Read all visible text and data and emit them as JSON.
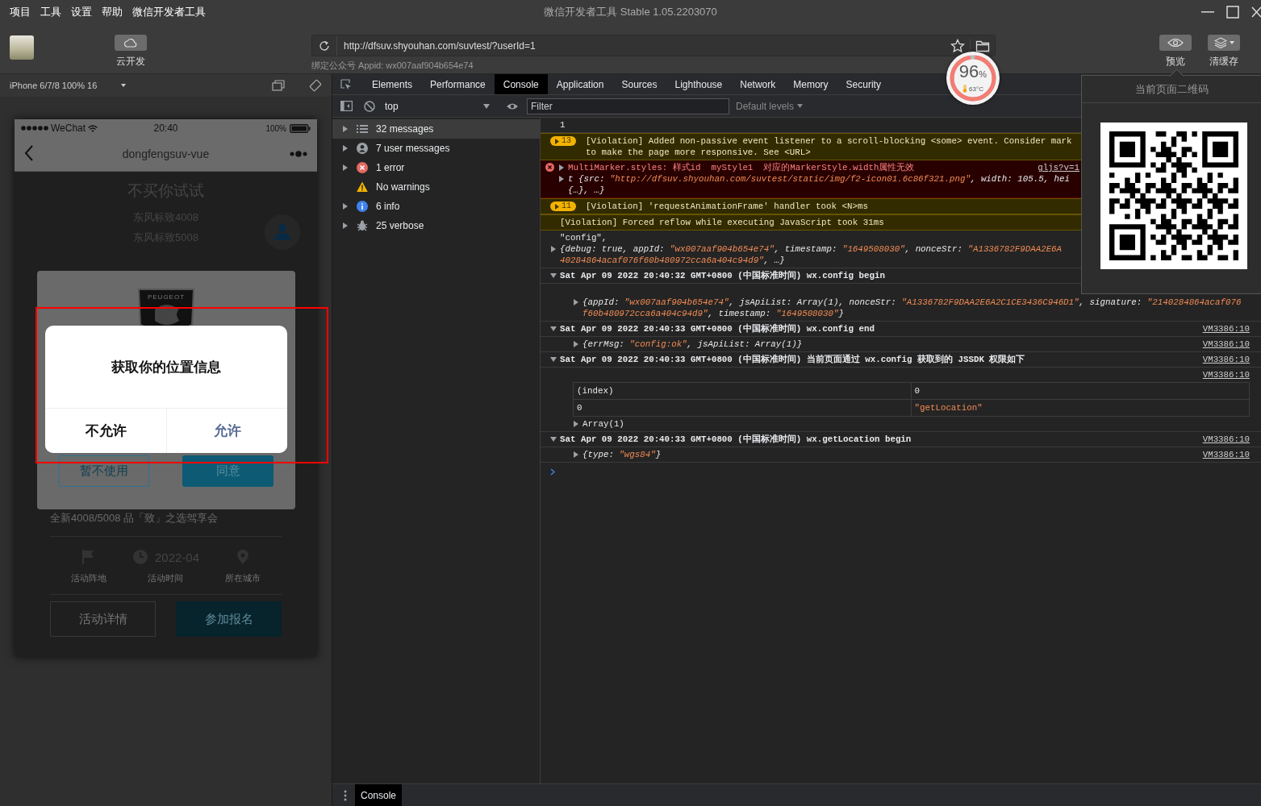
{
  "menu": [
    "项目",
    "工具",
    "设置",
    "帮助",
    "微信开发者工具"
  ],
  "window": {
    "title": "微信开发者工具 Stable 1.05.2203070"
  },
  "toolbar": {
    "cloud_button": {
      "label": "云开发"
    },
    "address": {
      "value": "http://dfsuv.shyouhan.com/suvtest/?userId=1"
    },
    "binding": "绑定公众号 Appid: wx007aaf904b654e74",
    "actions": [
      {
        "kind": "preview",
        "label": "预览"
      },
      {
        "kind": "cache",
        "label": "清缓存"
      }
    ]
  },
  "performance": {
    "value": "96",
    "unit": "%",
    "temperature": "63°C",
    "level": 0.96
  },
  "simulator": {
    "device": "iPhone 6/7/8 100% 16",
    "status_bar": {
      "carrier": "WeChat",
      "time": "20:40",
      "battery": "100%"
    },
    "nav_title": "dongfengsuv-vue",
    "page": {
      "title": "不买你试试",
      "models": [
        "东风标致4008",
        "东风标致5008"
      ],
      "event_title": "全新4008/5008 品「致」之选驾享会",
      "info": [
        {
          "kind": "venue",
          "label": "活动阵地"
        },
        {
          "kind": "time",
          "value": "2022-04",
          "label": "活动时间"
        },
        {
          "kind": "city",
          "label": "所在城市"
        }
      ],
      "buttons": [
        {
          "kind": "secondary",
          "label": "活动详情"
        },
        {
          "kind": "primary",
          "label": "参加报名"
        }
      ]
    },
    "agreement_modal": {
      "logo": "PEUGEOT",
      "buttons": [
        {
          "kind": "secondary",
          "label": "暂不使用"
        },
        {
          "kind": "primary",
          "label": "同意"
        }
      ]
    },
    "permission_dialog": {
      "title": "获取你的位置信息",
      "highlighted": true,
      "buttons": [
        {
          "kind": "deny",
          "label": "不允许"
        },
        {
          "kind": "allow",
          "label": "允许"
        }
      ]
    }
  },
  "devtools": {
    "tabs": [
      {
        "label": "Elements",
        "selected": false
      },
      {
        "label": "Performance",
        "selected": false
      },
      {
        "label": "Console",
        "selected": true
      },
      {
        "label": "Application",
        "selected": false
      },
      {
        "label": "Sources",
        "selected": false
      },
      {
        "label": "Lighthouse",
        "selected": false
      },
      {
        "label": "Network",
        "selected": false
      },
      {
        "label": "Memory",
        "selected": false
      },
      {
        "label": "Security",
        "selected": false
      }
    ],
    "context": "top",
    "filter": {
      "placeholder": "Filter"
    },
    "levels": "Default levels",
    "sidebar": [
      {
        "kind": "all",
        "label": "32 messages",
        "expandable": true,
        "selected": true
      },
      {
        "kind": "user",
        "label": "7 user messages",
        "expandable": true,
        "selected": false
      },
      {
        "kind": "error",
        "label": "1 error",
        "expandable": true,
        "selected": false
      },
      {
        "kind": "warning",
        "label": "No warnings",
        "expandable": false,
        "selected": false
      },
      {
        "kind": "info",
        "label": "6 info",
        "expandable": true,
        "selected": false
      },
      {
        "kind": "verbose",
        "label": "25 verbose",
        "expandable": true,
        "selected": false
      }
    ],
    "messages": [
      {
        "kind": "log",
        "lines": [
          "1"
        ]
      },
      {
        "kind": "violation",
        "count": "13",
        "lines": [
          "[Violation] Added non-passive event listener to a scroll-blocking <some> event. Consider mark",
          "to make the page more responsive. See <URL>"
        ]
      },
      {
        "kind": "error",
        "lines": [
          "MultiMarker.styles: 样式id  myStyle1  对应的MarkerStyle.width属性无效"
        ],
        "source": "gljs?v=1",
        "detail": [
          "t {src: \"http://dfsuv.shyouhan.com/suvtest/static/img/f2-icon01.6c86f321.png\", width: 105.5, hei",
          "{…}, …}"
        ]
      },
      {
        "kind": "violation",
        "count": "11",
        "lines": [
          "[Violation] 'requestAnimationFrame' handler took <N>ms"
        ]
      },
      {
        "kind": "violation",
        "lines": [
          "[Violation] Forced reflow while executing JavaScript took 31ms"
        ]
      },
      {
        "kind": "log",
        "lines": [
          "\"config\","
        ],
        "detail": [
          "{debug: true, appId: \"wx007aaf904b654e74\", timestamp: \"1649508030\", nonceStr: \"A1336782F9DAA2E6A",
          "40284864acaf076f60b480972cca6a404c94d9\", …}"
        ]
      },
      {
        "kind": "group",
        "expanded": true,
        "lines": [
          "Sat Apr 09 2022 20:40:32 GMT+0800 (中国标准时间) wx.config begin"
        ],
        "children": [
          {
            "kind": "object",
            "lines": [
              "{appId: \"wx007aaf904b654e74\", jsApiList: Array(1), nonceStr: \"A1336782F9DAA2E6A2C1CE3436C946D1\", signature: \"2140284864acaf076",
              "f60b480972cca6a404c94d9\", timestamp: \"1649508030\"}"
            ]
          }
        ]
      },
      {
        "kind": "group",
        "expanded": true,
        "lines": [
          "Sat Apr 09 2022 20:40:33 GMT+0800 (中国标准时间) wx.config end"
        ],
        "source": "VM3386:10",
        "children": [
          {
            "kind": "object",
            "lines": [
              "{errMsg: \"config:ok\", jsApiList: Array(1)}"
            ],
            "source": "VM3386:10"
          }
        ]
      },
      {
        "kind": "group",
        "expanded": true,
        "lines": [
          "Sat Apr 09 2022 20:40:33 GMT+0800 (中国标准时间) 当前页面通过 wx.config 获取到的 JSSDK 权限如下"
        ],
        "source": "VM3386:10",
        "children": [
          {
            "kind": "table",
            "source": "VM3386:10",
            "columns": [
              "(index)",
              "0"
            ],
            "rows": [
              [
                "0",
                "\"getLocation\""
              ]
            ],
            "summary": "Array(1)"
          }
        ]
      },
      {
        "kind": "group",
        "expanded": true,
        "lines": [
          "Sat Apr 09 2022 20:40:33 GMT+0800 (中国标准时间) wx.getLocation begin"
        ],
        "source": "VM3386:10",
        "children": [
          {
            "kind": "object",
            "lines": [
              "{type: \"wgs84\"}"
            ],
            "source": "VM3386:10"
          }
        ]
      },
      {
        "kind": "prompt"
      }
    ],
    "drawer": {
      "tabs": [
        {
          "label": "Console",
          "selected": true
        }
      ]
    }
  },
  "qr_popup": {
    "title": "当前页面二维码"
  }
}
